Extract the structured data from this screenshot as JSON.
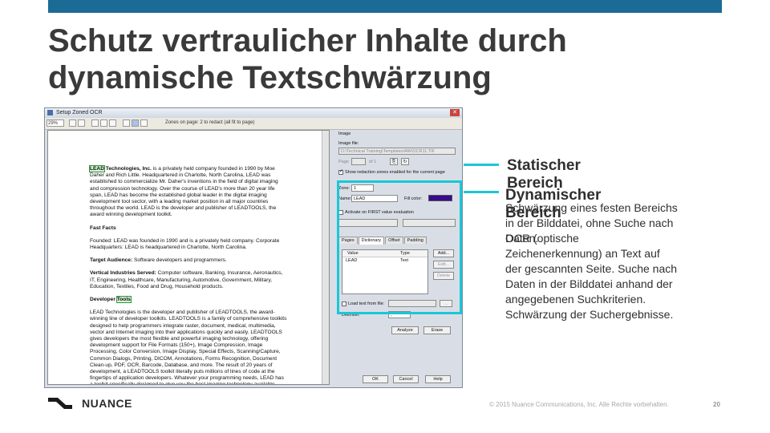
{
  "slide": {
    "title": "Schutz vertraulicher Inhalte durch dynamische Textschwärzung",
    "accent_color": "#1c6b96",
    "highlight_color": "#19c7d7"
  },
  "window": {
    "title": "Setup Zoned OCR",
    "zoom": "29%",
    "zones_label": "Zones on page: 2 to redact (all fit to page)"
  },
  "document": {
    "intro_brand": "LEAD",
    "intro_bold": "Technologies, Inc.",
    "intro_rest": " is a privately held company founded in 1990 by Moe Daher and Rich Little. Headquartered in Charlotte, North Carolina, LEAD was established to commercialize Mr. Daher's inventions in the field of digital imaging and compression technology. Over the course of LEAD's more than 20 year life span, LEAD has become the established global leader in the digital imaging development tool sector, with a leading market position in all major countries throughout the world. LEAD is the developer and publisher of LEADTOOLS, the award winning development toolkit.",
    "fast_facts_heading": "Fast Facts",
    "fast_facts": "Founded: LEAD was founded in 1990 and is a privately held company. Corporate Headquarters: LEAD is headquartered in Charlotte, North Carolina.",
    "target_label": "Target Audience:",
    "target_text": " Software developers and programmers.",
    "industries_label": "Vertical Industries Served:",
    "industries_text": " Computer software, Banking, Insurance, Aeronautics, IT, Engineering, Healthcare, Manufacturing, Automotive, Government, Military, Education, Textiles, Food and Drug, Household products.",
    "developer_label": "Developer",
    "developer_highlight": "Tools",
    "developer_text": "LEAD Technologies is the developer and publisher of LEADTOOLS, the award-winning line of developer toolkits. LEADTOOLS is a family of comprehensive toolkits designed to help programmers integrate raster, document, medical, multimedia, vector and Internet imaging into their applications quickly and easily. LEADTOOLS gives developers the most flexible and powerful imaging technology, offering development support for File Formats (150+), Image Compression, Image Processing, Color Conversion, Image Display, Special Effects, Scanning/Capture, Common Dialogs, Printing, DICOM, Annotations, Forms Recognition, Document Clean-up, PDF, OCR, Barcode, Database, and more. The result of 20 years of development, a LEADTOOLS toolkit literally puts millions of lines of code at the fingertips of application developers. Whatever your programming needs, LEAD has a toolkit specifically designed to give you the best imaging technology available."
  },
  "panel": {
    "image_group": "Image",
    "image_file_label": "Image file:",
    "image_file_value": "D:\\Technical Training\\Templates\\AW\\OCR11.TIF",
    "page_label": "Page",
    "page_of": "of 1",
    "show_zones_label": "Show redaction zones enabled for the current page",
    "zone_label": "Zone:",
    "zone_value": "1",
    "name_label": "Name:",
    "name_value": "LEAD",
    "fill_color_label": "Fill color:",
    "fill_color": "#3b0a8c",
    "activate_label": "Activate on FIRST value evaluation",
    "tabs": [
      "Pages",
      "Dictionary",
      "Offset",
      "Padding"
    ],
    "list_headers": [
      "Value",
      "Type"
    ],
    "list_row": {
      "value": "LEAD",
      "type": "Text"
    },
    "add_label": "Add...",
    "edit_label": "Edit...",
    "delete_label": "Delete",
    "load_label": "Load text from file:",
    "delimiter_label": "Delimiter:",
    "delimiter_value": ",",
    "analyze_label": "Analyze",
    "erase_label": "Erase",
    "ok_label": "OK",
    "cancel_label": "Cancel",
    "help_label": "Help"
  },
  "callouts": {
    "static_title": "Statischer Bereich",
    "static_text": "Schwärzung eines festen Bereichs in der Bilddatei, ohne Suche nach Daten.",
    "dynamic_title": "Dynamischer Bereich",
    "dynamic_text": "OCR (optische Zeichenerkennung) an Text auf der gescannten Seite. Suche nach Daten in der Bilddatei anhand der angegebenen Suchkriterien. Schwärzung der Suchergebnisse."
  },
  "footer": {
    "logo_text": "NUANCE",
    "copyright": "© 2015 Nuance Communications, Inc. Alle Rechte vorbehalten.",
    "page_number": "20"
  }
}
